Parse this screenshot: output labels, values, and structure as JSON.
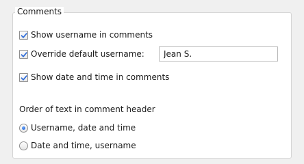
{
  "group": {
    "title": "Comments"
  },
  "options": {
    "show_username": {
      "label": "Show username in comments",
      "checked": true
    },
    "override_username": {
      "label": "Override default username:",
      "checked": true,
      "value": "Jean S."
    },
    "show_datetime": {
      "label": "Show date and time in comments",
      "checked": true
    }
  },
  "order": {
    "heading": "Order of text in comment header",
    "options": [
      {
        "label": "Username, date and time",
        "selected": true
      },
      {
        "label": "Date and time, username",
        "selected": false
      }
    ]
  },
  "colors": {
    "checkmark": "#2d6bd8",
    "radio_dot": "#1a58c7"
  }
}
